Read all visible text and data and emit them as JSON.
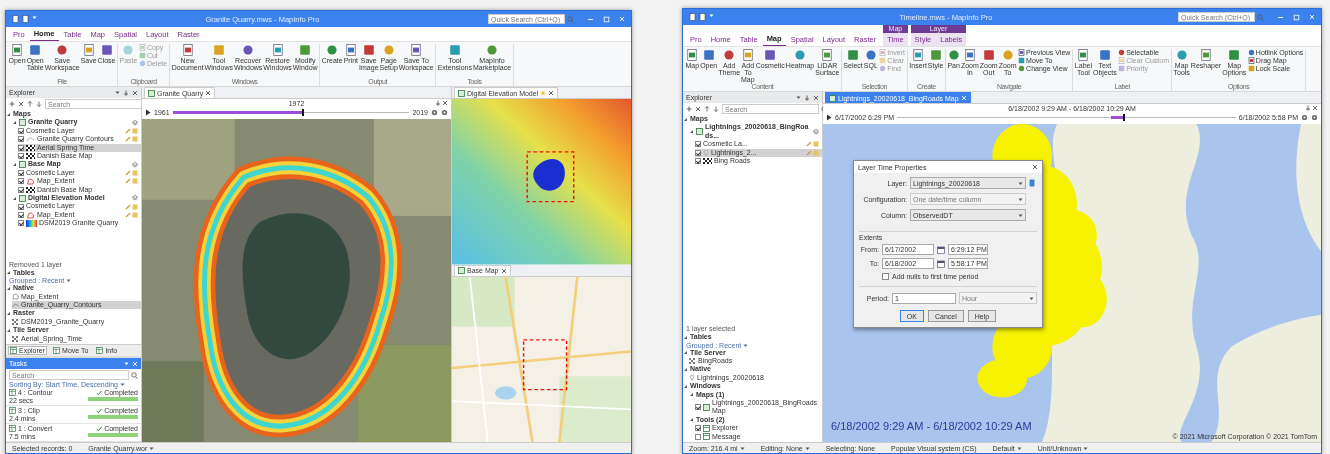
{
  "windows": [
    {
      "title": "Granite Quarry.mws - MapInfo Pro",
      "quick_search": {
        "placeholder": "Quick Search (Ctrl+Q)"
      },
      "ribbon": {
        "tabs": [
          {
            "kind": "tab",
            "label": "Pro",
            "selected": false
          },
          {
            "kind": "tab",
            "label": "Home",
            "selected": true
          },
          {
            "kind": "tab",
            "label": "Table",
            "selected": false
          },
          {
            "kind": "tab",
            "label": "Map",
            "selected": false
          },
          {
            "kind": "tab",
            "label": "Spatial",
            "selected": false
          },
          {
            "kind": "tab",
            "label": "Layout",
            "selected": false
          },
          {
            "kind": "tab",
            "label": "Raster",
            "selected": false
          }
        ],
        "groups": [
          {
            "label": "File",
            "buttons": [
              {
                "kind": "large",
                "label": "Open",
                "disabled": false
              },
              {
                "kind": "large",
                "label": "Open Table",
                "disabled": false
              },
              {
                "kind": "large",
                "label": "Save Workspace",
                "disabled": false
              },
              {
                "kind": "large",
                "label": "Save",
                "disabled": false
              },
              {
                "kind": "large",
                "label": "Close",
                "disabled": false
              }
            ]
          },
          {
            "label": "Clipboard",
            "buttons": [
              {
                "kind": "large",
                "label": "Paste",
                "disabled": true
              },
              {
                "kind": "small",
                "label": "Copy",
                "disabled": true
              },
              {
                "kind": "small",
                "label": "Cut",
                "disabled": true
              },
              {
                "kind": "small",
                "label": "Delete",
                "disabled": true
              }
            ]
          },
          {
            "label": "Windows",
            "buttons": [
              {
                "kind": "large",
                "label": "New Document",
                "disabled": false
              },
              {
                "kind": "large",
                "label": "Tool Windows",
                "disabled": false
              },
              {
                "kind": "large",
                "label": "Recover Windows",
                "disabled": false
              },
              {
                "kind": "large",
                "label": "Restore Windows",
                "disabled": false
              },
              {
                "kind": "large",
                "label": "Modify Window",
                "disabled": false
              }
            ]
          },
          {
            "label": "Output",
            "buttons": [
              {
                "kind": "large",
                "label": "Create",
                "disabled": false
              },
              {
                "kind": "large",
                "label": "Print",
                "disabled": false
              },
              {
                "kind": "large",
                "label": "Save Image",
                "disabled": false
              },
              {
                "kind": "large",
                "label": "Page Setup",
                "disabled": false
              },
              {
                "kind": "large",
                "label": "Save To Workspace",
                "disabled": false
              }
            ]
          },
          {
            "label": "Tools",
            "buttons": [
              {
                "kind": "large",
                "label": "Tool Extensions",
                "disabled": false
              },
              {
                "kind": "large",
                "label": "MapInfo Marketplace",
                "disabled": false
              }
            ]
          }
        ]
      },
      "explorer": {
        "title": "Explorer",
        "search": {
          "placeholder": "Search"
        },
        "sections": [
          {
            "kind": "tree",
            "nodes": [
              {
                "kind": "heading",
                "label": "Maps",
                "expanded": true,
                "children": [
                  {
                    "kind": "map",
                    "label": "Granite Quarry",
                    "expanded": true,
                    "children": [
                      {
                        "kind": "cosmetic",
                        "label": "Cosmetic Layer",
                        "checked": true,
                        "selected": false
                      },
                      {
                        "kind": "contour",
                        "label": "Granite Quarry Contours",
                        "checked": true,
                        "selected": false
                      },
                      {
                        "kind": "tile",
                        "label": "Aerial Spring Time",
                        "checked": true,
                        "selected": true
                      },
                      {
                        "kind": "tile",
                        "label": "Danish Base Map",
                        "checked": true,
                        "selected": false
                      }
                    ]
                  },
                  {
                    "kind": "map",
                    "label": "Base Map",
                    "expanded": true,
                    "children": [
                      {
                        "kind": "cosmetic",
                        "label": "Cosmetic Layer",
                        "checked": true,
                        "selected": false
                      },
                      {
                        "kind": "region",
                        "label": "Map_Extent",
                        "checked": true,
                        "selected": false
                      },
                      {
                        "kind": "tile",
                        "label": "Danish Base Map",
                        "checked": true,
                        "selected": false
                      }
                    ]
                  },
                  {
                    "kind": "map",
                    "label": "Digital Elevation Model",
                    "expanded": true,
                    "children": [
                      {
                        "kind": "cosmetic",
                        "label": "Cosmetic Layer",
                        "checked": true,
                        "selected": false
                      },
                      {
                        "kind": "region",
                        "label": "Map_Extent",
                        "checked": true,
                        "selected": false
                      },
                      {
                        "kind": "raster",
                        "label": "DSM2019 Granite Quarry",
                        "checked": true,
                        "selected": false
                      }
                    ]
                  }
                ]
              }
            ]
          },
          {
            "kind": "note",
            "text": "Removed 1 layer"
          },
          {
            "kind": "tree",
            "nodes": [
              {
                "kind": "heading",
                "label": "Tables",
                "expanded": true
              }
            ]
          },
          {
            "kind": "grouping",
            "text": "Grouped : Recent"
          },
          {
            "kind": "tree",
            "nodes": [
              {
                "kind": "heading",
                "label": "Native",
                "expanded": true,
                "children": [
                  {
                    "kind": "table-region",
                    "label": "Map_Extent",
                    "selected": false
                  },
                  {
                    "kind": "table-line",
                    "label": "Granite_Quarry_Contours",
                    "selected": true
                  }
                ]
              },
              {
                "kind": "heading",
                "label": "Raster",
                "expanded": true,
                "children": [
                  {
                    "kind": "table-tile",
                    "label": "DSM2019_Granite_Quarry",
                    "selected": false
                  }
                ]
              },
              {
                "kind": "heading",
                "label": "Tile Server",
                "expanded": true,
                "children": [
                  {
                    "kind": "table-tile",
                    "label": "Aerial_Spring_Time",
                    "selected": false
                  }
                ]
              }
            ]
          }
        ]
      },
      "panel_tabs": [
        {
          "label": "Explorer",
          "selected": true
        },
        {
          "label": "Move To",
          "selected": false
        },
        {
          "label": "Info",
          "selected": false
        }
      ],
      "tasks": {
        "title": "Tasks",
        "search": {
          "placeholder": "Search"
        },
        "sorting": "Sorting By: Start Time, Descending",
        "items": [
          {
            "title": "4 : Contour",
            "duration": "22 secs",
            "status": "Completed",
            "level": 1
          },
          {
            "title": "3 : Clip",
            "duration": "2.4 mins",
            "status": "Completed",
            "level": 1
          },
          {
            "title": "1 : Convert",
            "duration": "7.5 mins",
            "status": "Completed",
            "level": 1
          }
        ]
      },
      "documents": [
        {
          "kind": "quarry",
          "tab": "Granite Quarry",
          "timeline": {
            "kind": "cumulative",
            "start": "1961",
            "center": "1972",
            "end": "2019",
            "level": 0.55
          }
        },
        {
          "kind": "elevation",
          "tab": "Digital Elevation Model"
        },
        {
          "kind": "street",
          "tab": "Base Map"
        }
      ],
      "status_bar": [
        {
          "kind": "plain",
          "text": "Selected records: 0"
        },
        {
          "kind": "menu",
          "text": "Granite Quarry.wor"
        }
      ]
    },
    {
      "title": "Timeline.mws - MapInfo Pro",
      "quick_search": {
        "placeholder": "Quick Search (Ctrl+Q)"
      },
      "ribbon": {
        "tabs": [
          {
            "kind": "tab",
            "label": "Pro",
            "selected": false
          },
          {
            "kind": "tab",
            "label": "Home",
            "selected": false
          },
          {
            "kind": "tab",
            "label": "Table",
            "selected": false
          },
          {
            "kind": "tab",
            "label": "Map",
            "selected": true
          },
          {
            "kind": "tab",
            "label": "Spatial",
            "selected": false
          },
          {
            "kind": "tab",
            "label": "Layout",
            "selected": false
          },
          {
            "kind": "tab",
            "label": "Raster",
            "selected": false
          },
          {
            "kind": "context",
            "label": "Map",
            "tabs": [
              {
                "label": "Time",
                "selected": false
              }
            ]
          },
          {
            "kind": "context",
            "label": "Layer",
            "tabs": [
              {
                "label": "Style",
                "selected": false
              },
              {
                "label": "Labels",
                "selected": false
              }
            ]
          }
        ],
        "groups": [
          {
            "label": "Content",
            "buttons": [
              {
                "kind": "large",
                "label": "Map",
                "disabled": false
              },
              {
                "kind": "large",
                "label": "Open",
                "disabled": false
              },
              {
                "kind": "large",
                "label": "Add Theme",
                "disabled": false
              },
              {
                "kind": "large",
                "label": "Add To Map",
                "disabled": false
              },
              {
                "kind": "large",
                "label": "Cosmetic",
                "disabled": false
              },
              {
                "kind": "large",
                "label": "Heatmap",
                "disabled": false
              },
              {
                "kind": "large",
                "label": "LiDAR Surface",
                "disabled": false
              }
            ]
          },
          {
            "label": "Selection",
            "buttons": [
              {
                "kind": "large",
                "label": "Select",
                "disabled": false
              },
              {
                "kind": "large",
                "label": "SQL",
                "disabled": false
              },
              {
                "kind": "small",
                "label": "Invert",
                "disabled": true
              },
              {
                "kind": "small",
                "label": "Clear",
                "disabled": true
              },
              {
                "kind": "small",
                "label": "Find",
                "disabled": true
              }
            ]
          },
          {
            "label": "Create",
            "buttons": [
              {
                "kind": "large",
                "label": "Insert",
                "disabled": false
              },
              {
                "kind": "large",
                "label": "Style",
                "disabled": false
              }
            ]
          },
          {
            "label": "Navigate",
            "buttons": [
              {
                "kind": "large",
                "label": "Pan",
                "disabled": false
              },
              {
                "kind": "large",
                "label": "Zoom In",
                "disabled": false
              },
              {
                "kind": "large",
                "label": "Zoom Out",
                "disabled": false
              },
              {
                "kind": "large",
                "label": "Zoom To",
                "disabled": false
              },
              {
                "kind": "small",
                "label": "Previous View",
                "disabled": false
              },
              {
                "kind": "small",
                "label": "Move To",
                "disabled": false
              },
              {
                "kind": "small",
                "label": "Change View",
                "disabled": false
              }
            ]
          },
          {
            "label": "Label",
            "buttons": [
              {
                "kind": "large",
                "label": "Label Tool",
                "disabled": false
              },
              {
                "kind": "large",
                "label": "Text Objects",
                "disabled": false
              },
              {
                "kind": "small",
                "label": "Selectable",
                "disabled": false
              },
              {
                "kind": "small",
                "label": "Clear Custom",
                "disabled": true
              },
              {
                "kind": "small",
                "label": "Priority",
                "disabled": true
              }
            ]
          },
          {
            "label": "Options",
            "buttons": [
              {
                "kind": "large",
                "label": "Map Tools",
                "disabled": false
              },
              {
                "kind": "large",
                "label": "Reshaper",
                "disabled": false
              },
              {
                "kind": "large",
                "label": "Map Options",
                "disabled": false
              },
              {
                "kind": "small",
                "label": "Hotlink Options",
                "disabled": false
              },
              {
                "kind": "small",
                "label": "Drag Map",
                "disabled": false
              },
              {
                "kind": "small",
                "label": "Lock Scale",
                "disabled": false
              }
            ]
          }
        ]
      },
      "explorer": {
        "title": "Explorer",
        "search": {
          "placeholder": "Search"
        },
        "sections": [
          {
            "kind": "tree",
            "nodes": [
              {
                "kind": "heading",
                "label": "Maps",
                "expanded": true,
                "children": [
                  {
                    "kind": "map",
                    "label": "Lightnings_20020618_BingRoads...",
                    "expanded": true,
                    "children": [
                      {
                        "kind": "cosmetic",
                        "label": "Cosmetic La...",
                        "checked": true,
                        "selected": false
                      },
                      {
                        "kind": "point",
                        "label": "Lightnings_2...",
                        "checked": true,
                        "selected": true
                      },
                      {
                        "kind": "tile",
                        "label": "Bing Roads",
                        "checked": true,
                        "selected": false
                      }
                    ]
                  }
                ]
              }
            ]
          },
          {
            "kind": "note",
            "text": "1 layer selected"
          },
          {
            "kind": "tree",
            "nodes": [
              {
                "kind": "heading",
                "label": "Tables",
                "expanded": true
              }
            ]
          },
          {
            "kind": "grouping",
            "text": "Grouped : Recent"
          },
          {
            "kind": "tree",
            "nodes": [
              {
                "kind": "heading",
                "label": "Tile Server",
                "expanded": true,
                "children": [
                  {
                    "kind": "table-tile",
                    "label": "BingRoads",
                    "selected": false
                  }
                ]
              },
              {
                "kind": "heading",
                "label": "Native",
                "expanded": true,
                "children": [
                  {
                    "kind": "table-point",
                    "label": "Lightnings_20020618",
                    "selected": false
                  }
                ]
              }
            ]
          },
          {
            "kind": "tree",
            "nodes": [
              {
                "kind": "heading",
                "label": "Windows",
                "expanded": true,
                "children": [
                  {
                    "kind": "heading",
                    "label": "Maps (1)",
                    "expanded": true,
                    "children": [
                      {
                        "kind": "window-map",
                        "label": "Lightnings_20020618_BingRoads Map",
                        "checked": true
                      }
                    ]
                  },
                  {
                    "kind": "heading",
                    "label": "Tools (2)",
                    "expanded": true,
                    "children": [
                      {
                        "kind": "window-tool",
                        "label": "Explorer",
                        "checked": true
                      },
                      {
                        "kind": "window-tool",
                        "label": "Message",
                        "checked": false
                      }
                    ]
                  }
                ]
              }
            ]
          }
        ]
      },
      "documents": [
        {
          "kind": "lightning",
          "tab": "Lightnings_20020618_BingRoads Map",
          "timeline": {
            "kind": "window",
            "start": "6/17/2002 6:29 PM",
            "center": "6/18/2002 9:29 AM - 6/18/2002 10:29 AM",
            "end": "6/18/2002 5:58 PM",
            "level": 0.67
          },
          "overlay": "6/18/2002 9:29 AM - 6/18/2002 10:29 AM",
          "attribution": "© 2021 Microsoft Corporation © 2021 TomTom",
          "dialog": {
            "title": "Layer Time Properties",
            "fields": [
              {
                "kind": "select",
                "label": "Layer:",
                "value": "Lightnings_20020618",
                "disabled": false
              },
              {
                "kind": "select",
                "label": "Configuration:",
                "value": "One date/time column",
                "disabled": true
              },
              {
                "kind": "select",
                "label": "Column:",
                "value": "ObservedDT",
                "disabled": false
              }
            ],
            "extents": {
              "label": "Extents",
              "rows": [
                {
                  "label": "From:",
                  "date": "6/17/2002",
                  "time": "6:29:12 PM"
                },
                {
                  "label": "To:",
                  "date": "6/18/2002",
                  "time": "5:58:17 PM"
                }
              ]
            },
            "option": {
              "label": "Add nulls to first time period",
              "checked": false
            },
            "period": {
              "label": "Period:",
              "value": "1",
              "unit": "Hour"
            },
            "buttons": [
              "OK",
              "Cancel",
              "Help"
            ]
          }
        }
      ],
      "status_bar": [
        {
          "kind": "menu",
          "text": "Zoom: 216.4 mi"
        },
        {
          "kind": "menu",
          "text": "Editing: None"
        },
        {
          "kind": "plain",
          "text": "Selecting: None"
        },
        {
          "kind": "plain",
          "text": "Popular Visual system (CS)"
        },
        {
          "kind": "menu",
          "text": "Default"
        },
        {
          "kind": "menu",
          "text": "Unit/Unknown"
        }
      ]
    }
  ]
}
